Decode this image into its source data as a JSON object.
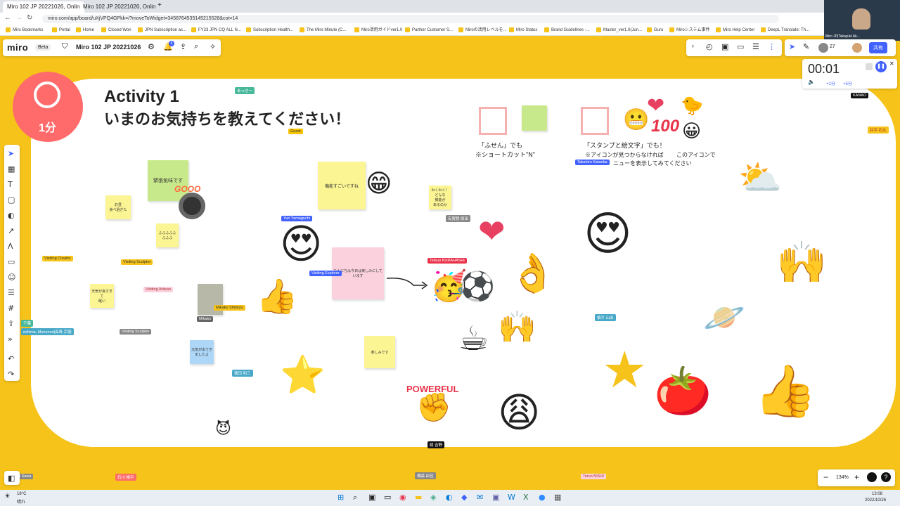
{
  "browser": {
    "tabs": [
      {
        "label": "Miro 102 JP 20221026, Onlin"
      },
      {
        "label": "Miro 102 JP 20221026, Onlin"
      }
    ],
    "url": "miro.com/app/board/uXjVPQ4GPkk=/?moveToWidget=3458764535145215528&cot=14",
    "bookmarks": [
      "Miro Bookmarks",
      "Portal",
      "Home",
      "Closed Won",
      "JPN Subscription ac...",
      "FY23 JPN CQ ALL N...",
      "Subscription Health...",
      "The Miro Minute (C...",
      "Miro活用ガイドver1.0",
      "Partner Customer S...",
      "Miroの活用レベルを...",
      "Miro Status",
      "Brand Guidelines -...",
      "Master_ver1.0(Jun...",
      "Guru",
      "Miroシステム事件",
      "Miro Help Center",
      "DeepL Translate: Th..."
    ]
  },
  "video": {
    "name": "Miro JP|Takayuki Ak..."
  },
  "toolbar": {
    "logo": "miro",
    "beta": "Beta",
    "board_name": "Miro 102 JP 20221026",
    "notif_count": "5",
    "share_label": "共有",
    "participants": "27"
  },
  "timer": {
    "value": "00:01",
    "plus1": "+1分",
    "plus5": "+5分"
  },
  "activity": {
    "badge": "1分",
    "title": "Activity 1",
    "subtitle": "いまのお気持ちを教えてください！"
  },
  "hints": {
    "sticky_line1": "「ふせん」でも",
    "sticky_line2": "※ショートカット\"N\"",
    "stamp_line1": "「スタンプと絵文字」でも！",
    "stamp_line2": "※アイコンが見つからなければ",
    "stamp_line3": "このアイコンで",
    "stamp_line4": "ニューを表示してみてください"
  },
  "stickies": {
    "s1": "緊張気味です",
    "s2": "お昼\n食べ過ぎた",
    "s3": "ふふふふふふふふ",
    "s4": "天気が良すぎて\n眠い",
    "s5": "機能すごいですね",
    "s6": "わくわく！\nどんな\n機能が\nあるのか",
    "s7": "こんにちは今日は楽しみにしています",
    "s8": "元気が出てきましたよ",
    "s9": "楽しみです"
  },
  "cursors": {
    "c1": "あっきー",
    "c2": "Guest",
    "c3": "Takahiro Kataoka",
    "c4": "KANAO",
    "c5": "井平 石丸",
    "c6": "Yuri Yamaguchi",
    "c7": "有賀慧 原田",
    "c8": "Tetsuo KURAHASHI",
    "c9": "Visiting Explorer",
    "c10": "Visiting Creator",
    "c11": "Visiting Sculptor",
    "c12": "Visiting Artisan",
    "c13": "Mikako Shimizu",
    "c14": "Mikako",
    "c15": "千葉",
    "c16": "eshima, Munenori|高島 宗徳",
    "c17": "Visiting Sculptor",
    "c18": "徳田 利三",
    "c19": "慎平 山田",
    "c20": "綾 吉野",
    "c21": "石川 暢平",
    "c22": "橋森 由佳",
    "c23": "Teruo NISHI",
    "c24": "ashi Sawa"
  },
  "stamps": {
    "gooo": "GOOO",
    "powerful": "POWERFUL",
    "hundred": "100"
  },
  "zoom": {
    "level": "134%"
  },
  "taskbar": {
    "weather_temp": "18°C",
    "weather_desc": "晴れ",
    "time": "13:08",
    "date": "2022/10/26"
  },
  "colors": {
    "board_bg": "#f6c31a",
    "badge": "#ff6b6b",
    "accent": "#4262ff"
  }
}
